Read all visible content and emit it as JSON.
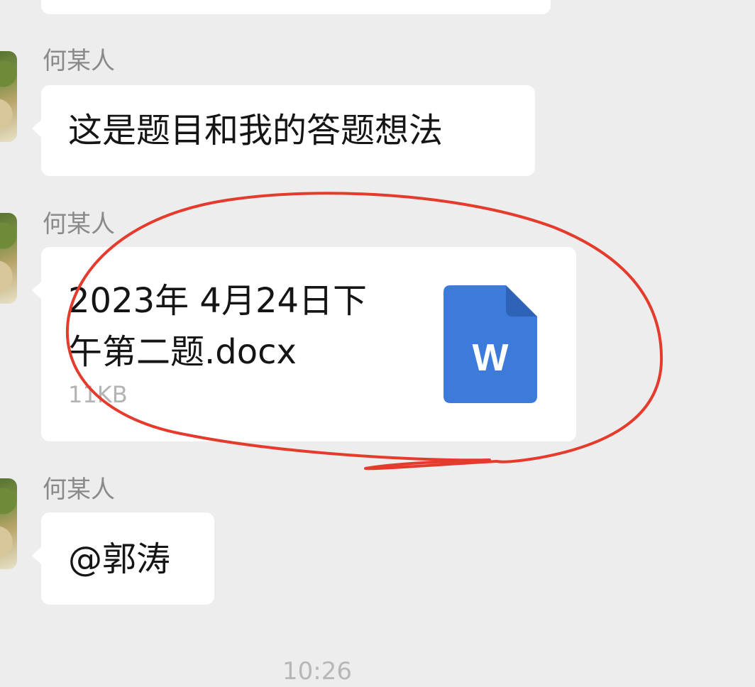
{
  "top_bubble": {
    "text": ""
  },
  "messages": [
    {
      "sender": "何某人",
      "text": "这是题目和我的答题想法"
    },
    {
      "sender": "何某人",
      "file": {
        "name_line1": "2023年 4月24日下",
        "name_line2": "午第二题.docx",
        "size": "11KB",
        "icon": "word-doc-icon",
        "icon_letter": "W"
      }
    },
    {
      "sender": "何某人",
      "text": "@郭涛"
    }
  ],
  "footer": {
    "time": "10:26"
  },
  "colors": {
    "background": "#ededed",
    "bubble": "#ffffff",
    "word_blue": "#3d7bdb",
    "annotation_red": "#e53b2d"
  }
}
